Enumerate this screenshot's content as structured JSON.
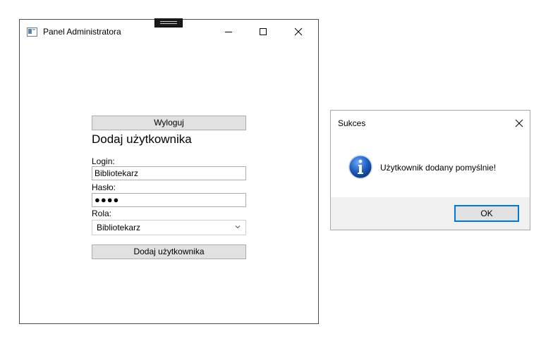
{
  "main_window": {
    "title": "Panel Administratora",
    "logout_label": "Wyloguj",
    "form_heading": "Dodaj użytkownika",
    "login_label": "Login:",
    "login_value": "Bibliotekarz",
    "password_label": "Hasło:",
    "password_value": "●●●●",
    "role_label": "Rola:",
    "role_selected": "Bibliotekarz",
    "add_user_label": "Dodaj użytkownika"
  },
  "message_box": {
    "title": "Sukces",
    "message": "Użytkownik dodany pomyślnie!",
    "ok_label": "OK",
    "icon": "info-icon"
  },
  "colors": {
    "button_face": "#e1e1e1",
    "button_border": "#adadad",
    "focus_border": "#0078d7",
    "info_icon_blue": "#1e5fbf",
    "dialog_footer": "#f0f0f0"
  }
}
